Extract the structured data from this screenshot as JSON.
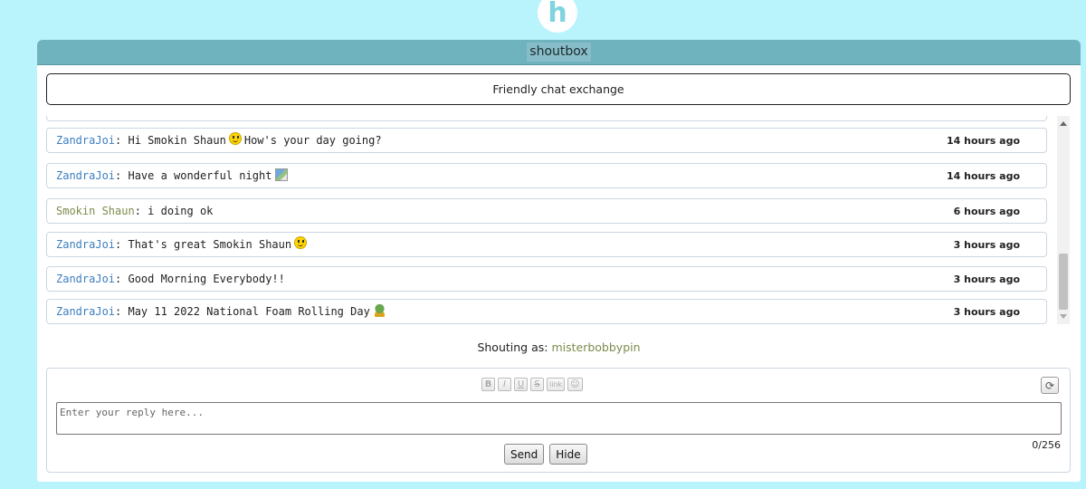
{
  "logo": {
    "letter": "h"
  },
  "panel": {
    "title": "shoutbox"
  },
  "topic": {
    "text": "Friendly chat exchange"
  },
  "messages": [
    {
      "user": "ZandraJoi",
      "text_before": "Hi Smokin Shaun",
      "emoji": "smiley",
      "text_after": "How's your day going?",
      "time": "14 hours ago"
    },
    {
      "user": "ZandraJoi",
      "text_before": "Have a wonderful night",
      "emoji": "broken-image",
      "text_after": "",
      "time": "14 hours ago"
    },
    {
      "user": "Smokin Shaun",
      "text_before": "i doing ok",
      "emoji": "",
      "text_after": "",
      "time": "6 hours ago"
    },
    {
      "user": "ZandraJoi",
      "text_before": "That's great Smokin Shaun",
      "emoji": "smiley",
      "text_after": "",
      "time": "3 hours ago"
    },
    {
      "user": "ZandraJoi",
      "text_before": "Good Morning Everybody!!",
      "emoji": "",
      "text_after": "",
      "time": "3 hours ago"
    },
    {
      "user": "ZandraJoi",
      "text_before": "May 11 2022 National Foam Rolling Day",
      "emoji": "frog",
      "text_after": "",
      "time": "3 hours ago"
    }
  ],
  "shouting_as": {
    "label": "Shouting as:",
    "user": "misterbobbypin"
  },
  "toolbar": {
    "bold": "B",
    "italic": "I",
    "underline": "U",
    "strike": "S",
    "link": "link",
    "emoji": "☺"
  },
  "compose": {
    "placeholder": "Enter your reply here...",
    "counter": "0/256",
    "send_label": "Send",
    "hide_label": "Hide",
    "refresh_icon": "⟳"
  },
  "colors": {
    "background": "#b9f3fc",
    "header": "#6fb3bf",
    "user_a": "#3d7ebf",
    "user_b": "#7a8c4c"
  }
}
